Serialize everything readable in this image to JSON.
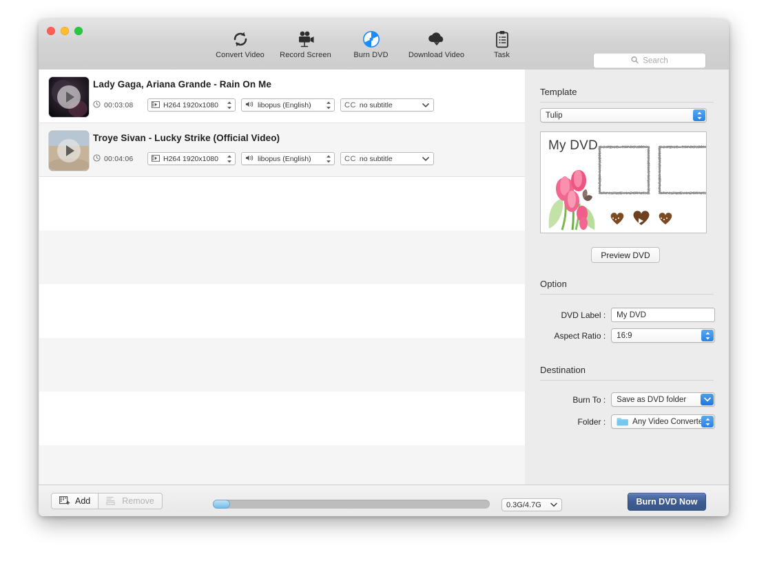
{
  "window": {
    "traffic_lights": [
      "close",
      "minimize",
      "zoom"
    ]
  },
  "toolbar": {
    "items": [
      {
        "label": "Convert Video",
        "icon": "convert-icon"
      },
      {
        "label": "Record Screen",
        "icon": "camera-icon"
      },
      {
        "label": "Burn DVD",
        "icon": "burn-disc-icon"
      },
      {
        "label": "Download Video",
        "icon": "cloud-download-icon"
      },
      {
        "label": "Task",
        "icon": "clipboard-icon"
      }
    ],
    "search_placeholder": "Search",
    "search_value": ""
  },
  "list": {
    "rows": [
      {
        "title": "Lady Gaga, Ariana Grande - Rain On Me",
        "duration": "00:03:08",
        "video": "H264 1920x1080",
        "audio": "libopus (English)",
        "subtitle_tag": "CC",
        "subtitle": "no subtitle"
      },
      {
        "title": "Troye Sivan - Lucky Strike (Official Video)",
        "duration": "00:04:06",
        "video": "H264 1920x1080",
        "audio": "libopus (English)",
        "subtitle_tag": "CC",
        "subtitle": "no subtitle"
      }
    ],
    "empty_row_count": 6
  },
  "panel": {
    "template": {
      "heading": "Template",
      "selected": "Tulip",
      "preview_title": "My DVD",
      "preview_button": "Preview DVD"
    },
    "option": {
      "heading": "Option",
      "dvd_label_label": "DVD Label :",
      "dvd_label_value": "My DVD",
      "aspect_label": "Aspect Ratio :",
      "aspect_value": "16:9"
    },
    "destination": {
      "heading": "Destination",
      "burn_to_label": "Burn To :",
      "burn_to_value": "Save as DVD folder",
      "folder_label": "Folder  :",
      "folder_value": "Any Video Converte..."
    }
  },
  "bottom": {
    "add_label": "Add",
    "remove_label": "Remove",
    "progress_value": 6,
    "size_value": "0.3G/4.7G",
    "burn_label": "Burn DVD Now"
  },
  "colors": {
    "accent_blue": "#2a82e0",
    "burn_button": "#3f5d95",
    "disc_blue": "#1a8cff"
  }
}
